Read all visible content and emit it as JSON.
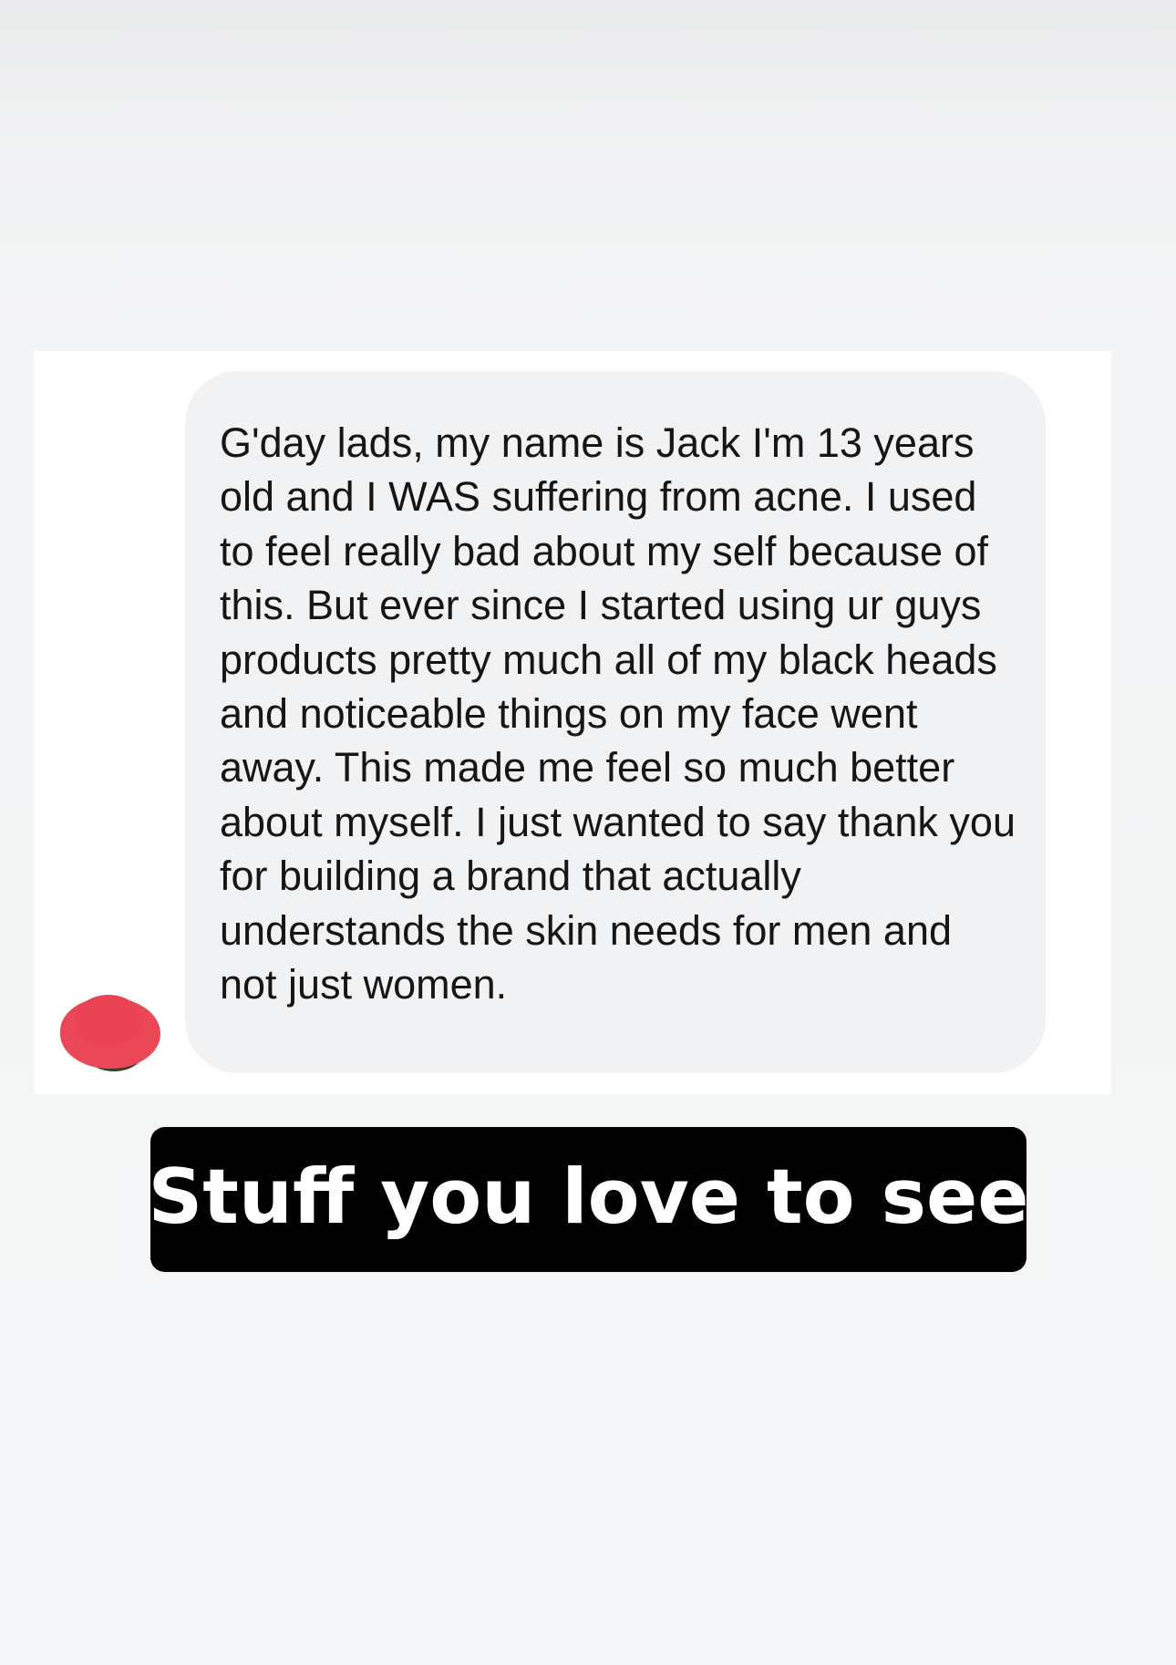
{
  "message": {
    "text": "G'day lads, my name is Jack I'm 13 years old and I WAS suffering from acne. I used to feel really bad about my self because of this. But ever since I started using ur guys products pretty much all of my black heads and noticeable things on my face went away. This made me feel so much better about myself. I just wanted to say thank you for building a brand that actually understands the skin needs for men and not just women."
  },
  "avatar": {
    "icon": "redacted-avatar-icon",
    "scribble_color": "#ea4857"
  },
  "caption": {
    "text": "Stuff you love to see"
  },
  "colors": {
    "page_background": "#f5f6f7",
    "card_background": "#ffffff",
    "bubble_background": "#f1f2f4",
    "message_text": "#161616",
    "caption_background": "#000000",
    "caption_text": "#ffffff"
  }
}
